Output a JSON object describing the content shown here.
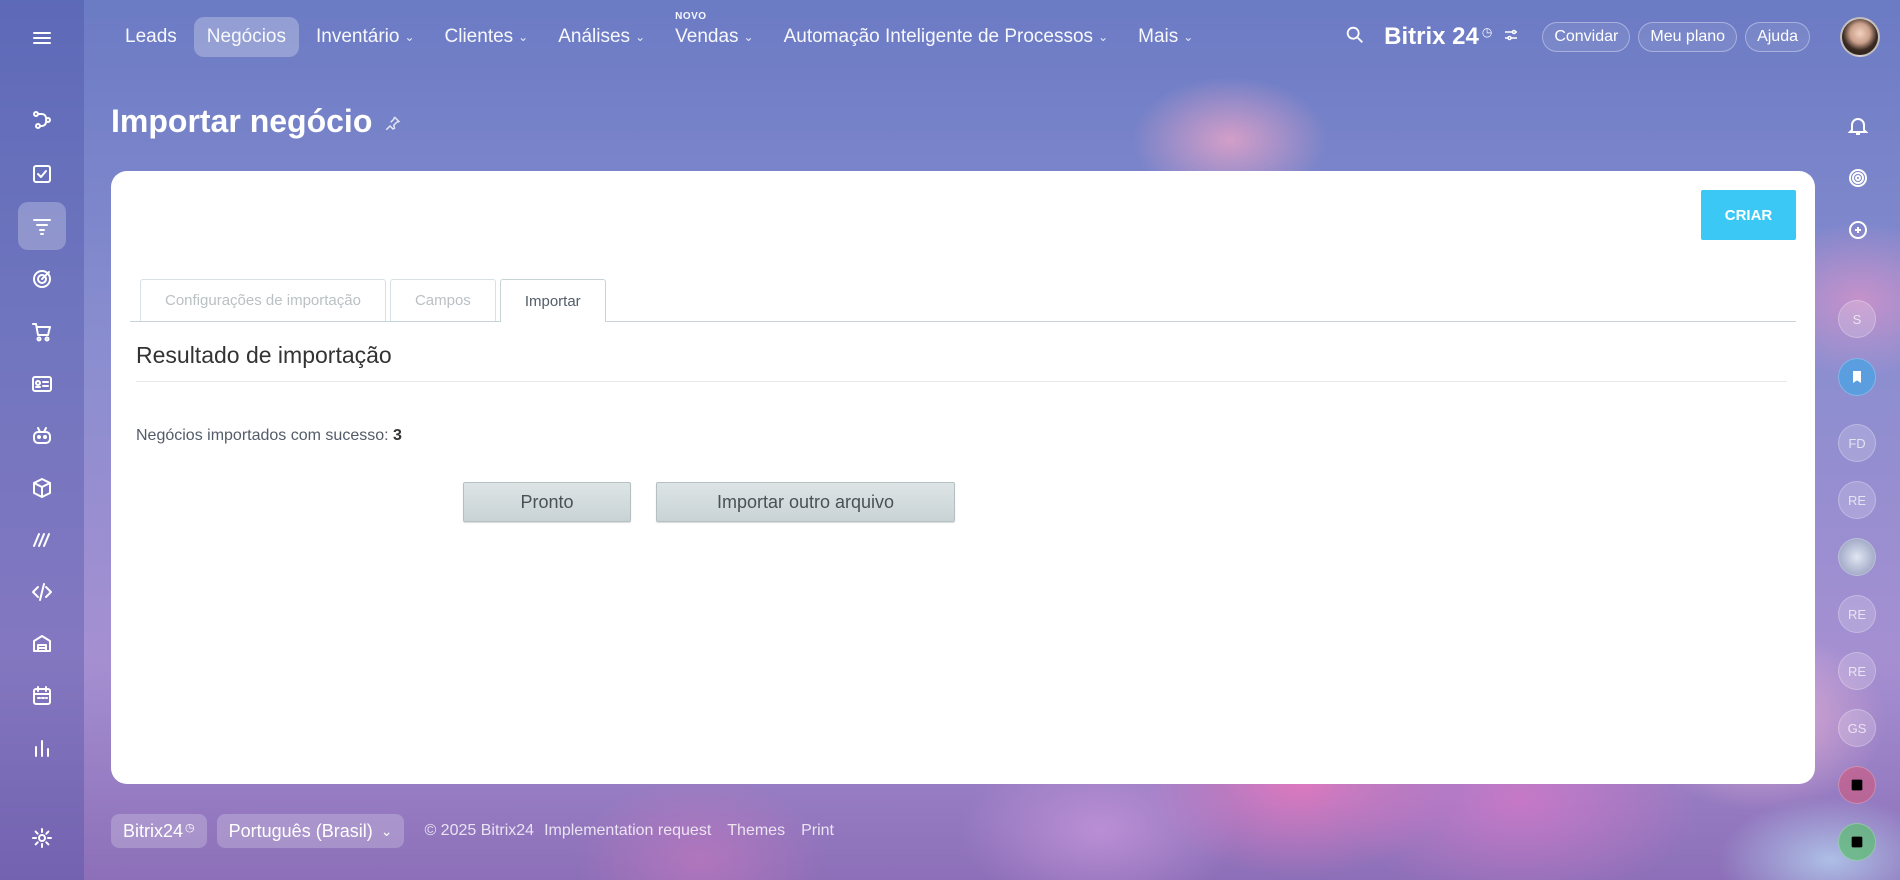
{
  "nav": {
    "items": [
      {
        "label": "Leads",
        "chevron": false,
        "badge": ""
      },
      {
        "label": "Negócios",
        "chevron": false,
        "badge": "",
        "active": true
      },
      {
        "label": "Inventário",
        "chevron": true,
        "badge": ""
      },
      {
        "label": "Clientes",
        "chevron": true,
        "badge": ""
      },
      {
        "label": "Análises",
        "chevron": true,
        "badge": ""
      },
      {
        "label": "Vendas",
        "chevron": true,
        "badge": "NOVO"
      },
      {
        "label": "Automação Inteligente de Processos",
        "chevron": true,
        "badge": ""
      },
      {
        "label": "Mais",
        "chevron": true,
        "badge": ""
      }
    ]
  },
  "header": {
    "brand": "Bitrix 24",
    "invite": "Convidar",
    "plan": "Meu plano",
    "help": "Ajuda"
  },
  "page": {
    "title": "Importar negócio",
    "create_label": "CRIAR"
  },
  "tabs": [
    "Configurações de importação",
    "Campos",
    "Importar"
  ],
  "result": {
    "title": "Resultado de importação",
    "success_label": "Negócios importados com sucesso: ",
    "success_count": "3",
    "done_label": "Pronto",
    "import_another_label": "Importar outro arquivo"
  },
  "rail": {
    "avatars": [
      "S",
      "",
      "FD",
      "RE",
      "",
      "RE",
      "RE",
      "GS"
    ]
  },
  "footer": {
    "brand": "Bitrix24",
    "language": "Português (Brasil)",
    "copyright": "© 2025 Bitrix24",
    "implementation": "Implementation request",
    "themes": "Themes",
    "print": "Print"
  },
  "colors": {
    "accent": "#3bc8f5",
    "button_gray": "#c9d3d5"
  }
}
